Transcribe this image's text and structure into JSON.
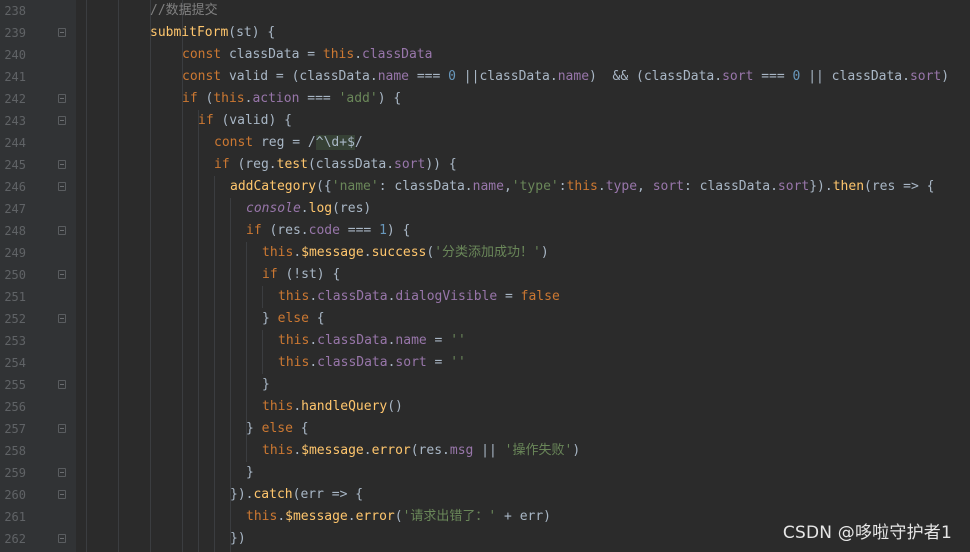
{
  "editor": {
    "lines": [
      {
        "num": "238",
        "fold": false,
        "indent": 150,
        "tokens": [
          [
            "c",
            "//数据提交"
          ]
        ]
      },
      {
        "num": "239",
        "fold": true,
        "indent": 150,
        "tokens": [
          [
            "f",
            "submitForm"
          ],
          [
            "",
            "(st) {"
          ]
        ]
      },
      {
        "num": "240",
        "fold": false,
        "indent": 182,
        "tokens": [
          [
            "k",
            "const "
          ],
          [
            "",
            "classData = "
          ],
          [
            "k",
            "this"
          ],
          [
            "",
            "."
          ],
          [
            "p",
            "classData"
          ]
        ]
      },
      {
        "num": "241",
        "fold": false,
        "indent": 182,
        "tokens": [
          [
            "k",
            "const "
          ],
          [
            "",
            "valid = (classData."
          ],
          [
            "p",
            "name"
          ],
          [
            "",
            " === "
          ],
          [
            "n",
            "0"
          ],
          [
            "",
            " ||classData."
          ],
          [
            "p",
            "name"
          ],
          [
            "",
            ")  && (classData."
          ],
          [
            "p",
            "sort"
          ],
          [
            "",
            " === "
          ],
          [
            "n",
            "0"
          ],
          [
            "",
            " || classData."
          ],
          [
            "p",
            "sort"
          ],
          [
            "",
            ")"
          ]
        ]
      },
      {
        "num": "242",
        "fold": true,
        "indent": 182,
        "tokens": [
          [
            "k",
            "if "
          ],
          [
            "",
            "("
          ],
          [
            "k",
            "this"
          ],
          [
            "",
            "."
          ],
          [
            "p",
            "action"
          ],
          [
            "",
            " === "
          ],
          [
            "s",
            "'add'"
          ],
          [
            "",
            ") {"
          ]
        ]
      },
      {
        "num": "243",
        "fold": true,
        "indent": 198,
        "tokens": [
          [
            "k",
            "if "
          ],
          [
            "",
            "(valid) {"
          ]
        ]
      },
      {
        "num": "244",
        "fold": false,
        "indent": 214,
        "tokens": [
          [
            "k",
            "const "
          ],
          [
            "",
            "reg = /"
          ],
          [
            "rx",
            "^\\d+$"
          ],
          [
            "",
            "/"
          ]
        ]
      },
      {
        "num": "245",
        "fold": true,
        "indent": 214,
        "tokens": [
          [
            "k",
            "if "
          ],
          [
            "",
            "(reg."
          ],
          [
            "f",
            "test"
          ],
          [
            "",
            "(classData."
          ],
          [
            "p",
            "sort"
          ],
          [
            "",
            ")) {"
          ]
        ]
      },
      {
        "num": "246",
        "fold": true,
        "indent": 230,
        "tokens": [
          [
            "f",
            "addCategory"
          ],
          [
            "",
            "({"
          ],
          [
            "s",
            "'name'"
          ],
          [
            "",
            ": classData."
          ],
          [
            "p",
            "name"
          ],
          [
            "",
            ","
          ],
          [
            "s",
            "'type'"
          ],
          [
            "",
            ":"
          ],
          [
            "k",
            "this"
          ],
          [
            "",
            "."
          ],
          [
            "p",
            "type"
          ],
          [
            "",
            ", "
          ],
          [
            "p",
            "sort"
          ],
          [
            "",
            ": classData."
          ],
          [
            "p",
            "sort"
          ],
          [
            "",
            "})."
          ],
          [
            "f",
            "then"
          ],
          [
            "",
            "(res => {"
          ]
        ]
      },
      {
        "num": "247",
        "fold": false,
        "indent": 246,
        "tokens": [
          [
            "it",
            "console"
          ],
          [
            "",
            "."
          ],
          [
            "f",
            "log"
          ],
          [
            "",
            "(res)"
          ]
        ]
      },
      {
        "num": "248",
        "fold": true,
        "indent": 246,
        "tokens": [
          [
            "k",
            "if "
          ],
          [
            "",
            "(res."
          ],
          [
            "p",
            "code"
          ],
          [
            "",
            " === "
          ],
          [
            "n",
            "1"
          ],
          [
            "",
            ") {"
          ]
        ]
      },
      {
        "num": "249",
        "fold": false,
        "indent": 262,
        "tokens": [
          [
            "k",
            "this"
          ],
          [
            "",
            "."
          ],
          [
            "f",
            "$message"
          ],
          [
            "",
            "."
          ],
          [
            "f",
            "success"
          ],
          [
            "",
            "("
          ],
          [
            "s",
            "'分类添加成功！'"
          ],
          [
            "",
            ")"
          ]
        ]
      },
      {
        "num": "250",
        "fold": true,
        "indent": 262,
        "tokens": [
          [
            "k",
            "if "
          ],
          [
            "",
            "(!st) {"
          ]
        ]
      },
      {
        "num": "251",
        "fold": false,
        "indent": 278,
        "tokens": [
          [
            "k",
            "this"
          ],
          [
            "",
            "."
          ],
          [
            "p",
            "classData"
          ],
          [
            "",
            "."
          ],
          [
            "p",
            "dialogVisible"
          ],
          [
            "",
            " = "
          ],
          [
            "k",
            "false"
          ]
        ]
      },
      {
        "num": "252",
        "fold": true,
        "indent": 262,
        "tokens": [
          [
            "",
            "} "
          ],
          [
            "k",
            "else "
          ],
          [
            "",
            "{"
          ]
        ]
      },
      {
        "num": "253",
        "fold": false,
        "indent": 278,
        "tokens": [
          [
            "k",
            "this"
          ],
          [
            "",
            "."
          ],
          [
            "p",
            "classData"
          ],
          [
            "",
            "."
          ],
          [
            "p",
            "name"
          ],
          [
            "",
            " = "
          ],
          [
            "s",
            "''"
          ]
        ]
      },
      {
        "num": "254",
        "fold": false,
        "indent": 278,
        "tokens": [
          [
            "k",
            "this"
          ],
          [
            "",
            "."
          ],
          [
            "p",
            "classData"
          ],
          [
            "",
            "."
          ],
          [
            "p",
            "sort"
          ],
          [
            "",
            " = "
          ],
          [
            "s",
            "''"
          ]
        ]
      },
      {
        "num": "255",
        "fold": true,
        "indent": 262,
        "tokens": [
          [
            "",
            "}"
          ]
        ]
      },
      {
        "num": "256",
        "fold": false,
        "indent": 262,
        "tokens": [
          [
            "k",
            "this"
          ],
          [
            "",
            "."
          ],
          [
            "f",
            "handleQuery"
          ],
          [
            "",
            "()"
          ]
        ]
      },
      {
        "num": "257",
        "fold": true,
        "indent": 246,
        "tokens": [
          [
            "",
            "} "
          ],
          [
            "k",
            "else "
          ],
          [
            "",
            "{"
          ]
        ]
      },
      {
        "num": "258",
        "fold": false,
        "indent": 262,
        "tokens": [
          [
            "k",
            "this"
          ],
          [
            "",
            "."
          ],
          [
            "f",
            "$message"
          ],
          [
            "",
            "."
          ],
          [
            "f",
            "error"
          ],
          [
            "",
            "(res."
          ],
          [
            "p",
            "msg"
          ],
          [
            "",
            " || "
          ],
          [
            "s",
            "'操作失败'"
          ],
          [
            "",
            ")"
          ]
        ]
      },
      {
        "num": "259",
        "fold": true,
        "indent": 246,
        "tokens": [
          [
            "",
            "}"
          ]
        ]
      },
      {
        "num": "260",
        "fold": true,
        "indent": 230,
        "tokens": [
          [
            "",
            "})."
          ],
          [
            "f",
            "catch"
          ],
          [
            "",
            "(err => {"
          ]
        ]
      },
      {
        "num": "261",
        "fold": false,
        "indent": 246,
        "tokens": [
          [
            "k",
            "this"
          ],
          [
            "",
            "."
          ],
          [
            "f",
            "$message"
          ],
          [
            "",
            "."
          ],
          [
            "f",
            "error"
          ],
          [
            "",
            "("
          ],
          [
            "s",
            "'请求出错了：'"
          ],
          [
            "",
            " + err)"
          ]
        ]
      },
      {
        "num": "262",
        "fold": true,
        "indent": 230,
        "tokens": [
          [
            "",
            "})"
          ]
        ]
      }
    ]
  },
  "watermark": "CSDN @哆啦守护者1"
}
